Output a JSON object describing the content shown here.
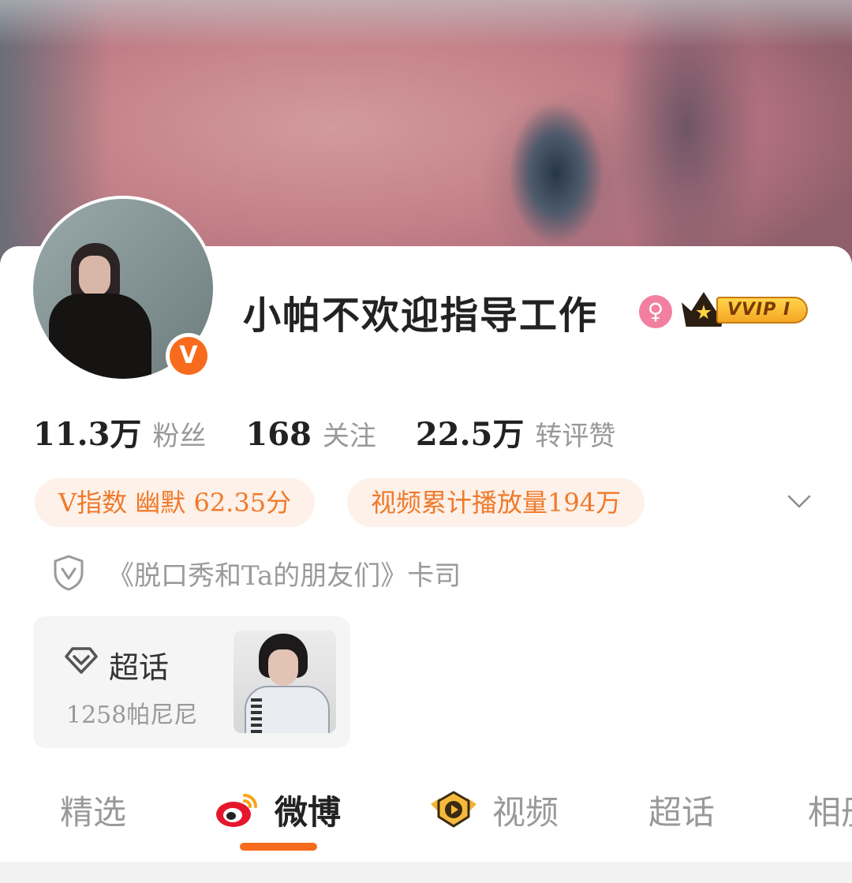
{
  "profile": {
    "name": "小帕不欢迎指导工作",
    "verified_badge_letter": "V",
    "vip_label": "VVIP I",
    "gender_symbol": "♀"
  },
  "stats": [
    {
      "value": "11.3万",
      "label": "粉丝"
    },
    {
      "value": "168",
      "label": "关注"
    },
    {
      "value": "22.5万",
      "label": "转评赞"
    }
  ],
  "tags": [
    {
      "label": "V指数 幽默 62.35分"
    },
    {
      "label": "视频累计播放量194万"
    }
  ],
  "description": "《脱口秀和Ta的朋友们》卡司",
  "super_topic": {
    "title": "超话",
    "subtitle": "1258帕尼尼"
  },
  "tabs": [
    {
      "label": "精选",
      "active": false
    },
    {
      "label": "微博",
      "active": true,
      "icon": "weibo-icon"
    },
    {
      "label": "视频",
      "active": false,
      "icon": "video-play-icon"
    },
    {
      "label": "超话",
      "active": false
    },
    {
      "label": "相册",
      "active": false
    }
  ],
  "colors": {
    "accent": "#f86b1d",
    "tag_bg": "#fdf1e9",
    "tag_text": "#f0792a",
    "muted_text": "#999999",
    "primary_text": "#222222"
  }
}
